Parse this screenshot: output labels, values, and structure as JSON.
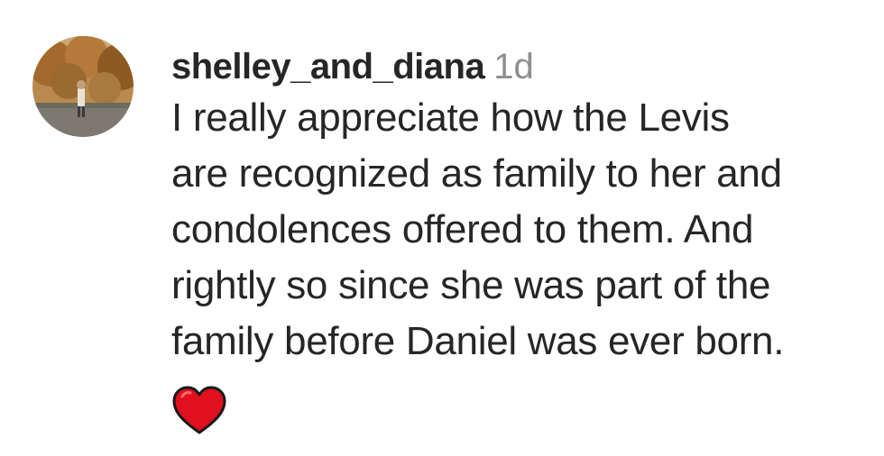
{
  "comment": {
    "username": "shelley_and_diana",
    "timestamp": "1d",
    "lines": [
      "I really appreciate how the Levis",
      "are recognized as family to her and",
      "condolences offered to them. And",
      "rightly so since she was part of the",
      "family before Daniel was ever born."
    ],
    "reaction_icon": "red-heart-emoji",
    "colors": {
      "text": "#262626",
      "timestamp": "#8e8e8e",
      "heart": "#e0101e"
    }
  }
}
